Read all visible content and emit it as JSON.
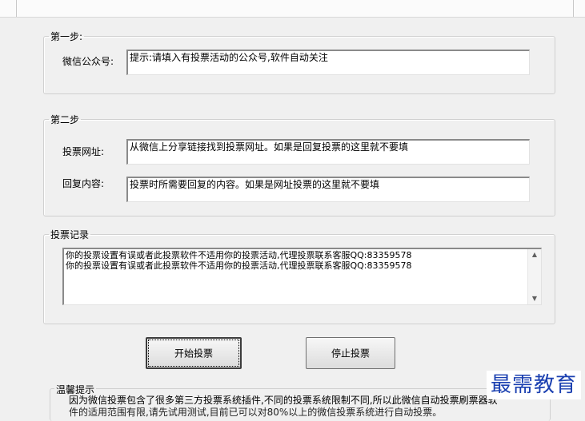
{
  "step1": {
    "legend": "第一步:",
    "account_label": "微信公众号:",
    "account_value": "提示:请填入有投票活动的公众号,软件自动关注"
  },
  "step2": {
    "legend": "第二步",
    "url_label": "投票网址:",
    "url_value": "从微信上分享链接找到投票网址。如果是回复投票的这里就不要填",
    "reply_label": "回复内容:",
    "reply_value": "投票时所需要回复的内容。如果是网址投票的这里就不要填"
  },
  "log": {
    "legend": "投票记录",
    "lines": [
      "你的投票设置有误或者此投票软件不适用你的投票活动,代理投票联系客服QQ:83359578",
      "你的投票设置有误或者此投票软件不适用你的投票活动,代理投票联系客服QQ:83359578"
    ]
  },
  "buttons": {
    "start_label": "开始投票",
    "stop_label": "停止投票"
  },
  "tips": {
    "title": "温馨提示",
    "line1": "因为微信投票包含了很多第三方投票系统插件,不同的投票系统限制不同,所以此微信自动投票刷票器软",
    "line2": "件的适用范围有限,请先试用测试,目前已可以对80%以上的微信投票系统进行自动投票。"
  },
  "watermark": {
    "text": "最需教育"
  }
}
